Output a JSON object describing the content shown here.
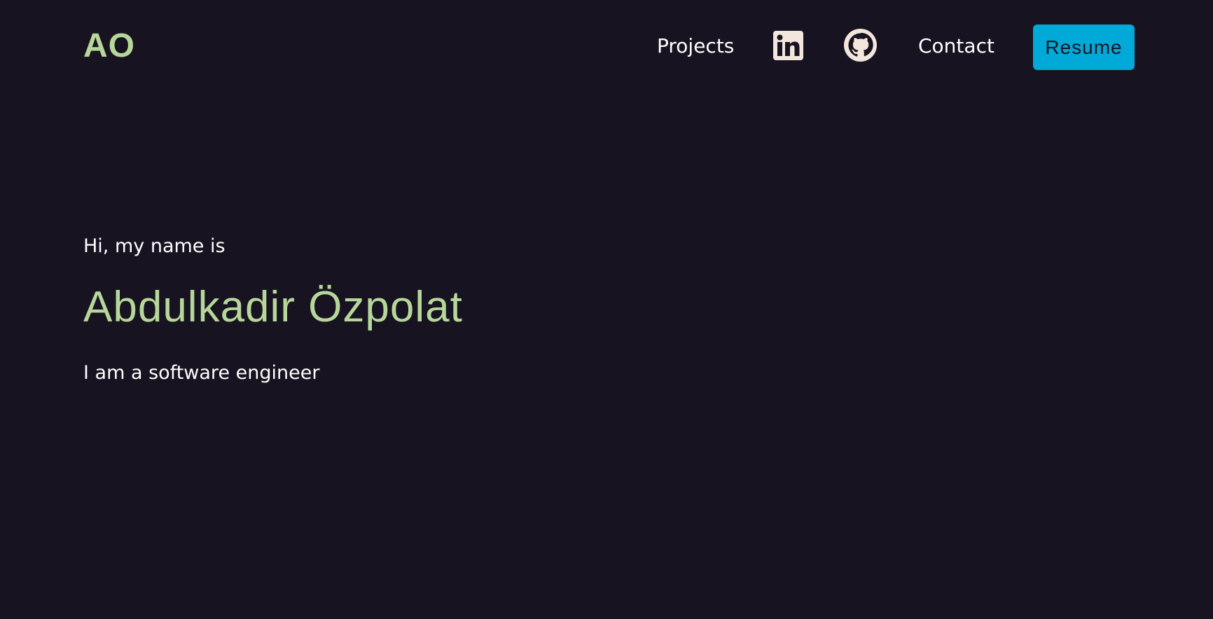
{
  "header": {
    "logo_text": "AO",
    "nav": {
      "projects_label": "Projects",
      "linkedin_icon": "linkedin-icon",
      "github_icon": "github-icon",
      "contact_label": "Contact",
      "resume_label": "Resume"
    }
  },
  "hero": {
    "intro": "Hi, my name is",
    "name": "Abdulkadir Özpolat",
    "tagline": "I am a software engineer"
  },
  "colors": {
    "background": "#171320",
    "accent_green": "#b7d79a",
    "resume_button": "#00a9d8",
    "text": "#ffffff",
    "icon_fill": "#f3e6dc"
  }
}
